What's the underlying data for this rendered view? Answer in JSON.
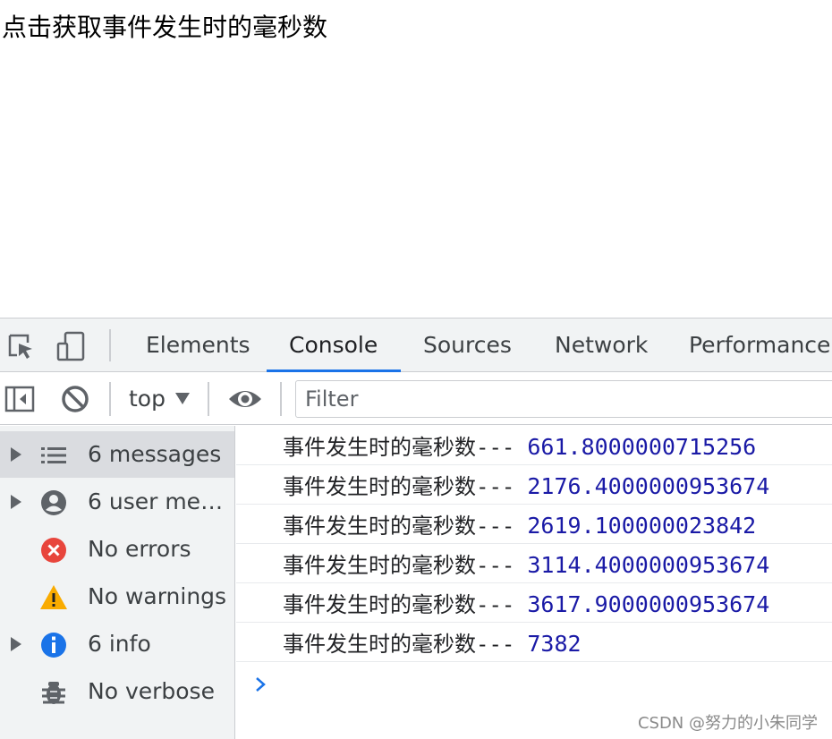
{
  "page": {
    "heading": "点击获取事件发生时的毫秒数"
  },
  "devtools": {
    "tabs": [
      {
        "label": "Elements"
      },
      {
        "label": "Console"
      },
      {
        "label": "Sources"
      },
      {
        "label": "Network"
      },
      {
        "label": "Performance"
      }
    ],
    "active_tab": "Console",
    "toolbar": {
      "context": "top",
      "filter_placeholder": "Filter"
    },
    "sidebar": [
      {
        "label": "6 messages",
        "icon": "list-icon",
        "expandable": true,
        "selected": true
      },
      {
        "label": "6 user mes…",
        "icon": "user-icon",
        "expandable": true,
        "selected": false
      },
      {
        "label": "No errors",
        "icon": "error-icon",
        "expandable": false,
        "selected": false
      },
      {
        "label": "No warnings",
        "icon": "warning-icon",
        "expandable": false,
        "selected": false
      },
      {
        "label": "6 info",
        "icon": "info-icon",
        "expandable": true,
        "selected": false
      },
      {
        "label": "No verbose",
        "icon": "bug-icon",
        "expandable": false,
        "selected": false
      }
    ],
    "messages": [
      {
        "label": "事件发生时的毫秒数",
        "dash": "---",
        "value": "661.8000000715256"
      },
      {
        "label": "事件发生时的毫秒数",
        "dash": "---",
        "value": "2176.4000000953674"
      },
      {
        "label": "事件发生时的毫秒数",
        "dash": "---",
        "value": "2619.100000023842"
      },
      {
        "label": "事件发生时的毫秒数",
        "dash": "---",
        "value": "3114.4000000953674"
      },
      {
        "label": "事件发生时的毫秒数",
        "dash": "---",
        "value": "3617.9000000953674"
      },
      {
        "label": "事件发生时的毫秒数",
        "dash": "---",
        "value": "7382"
      }
    ],
    "colors": {
      "accent": "#1a73e8",
      "number": "#1a1aa6",
      "error": "#e8453c",
      "warning": "#f9ab00",
      "info": "#1a73e8"
    }
  },
  "watermark": "CSDN @努力的小朱同学"
}
